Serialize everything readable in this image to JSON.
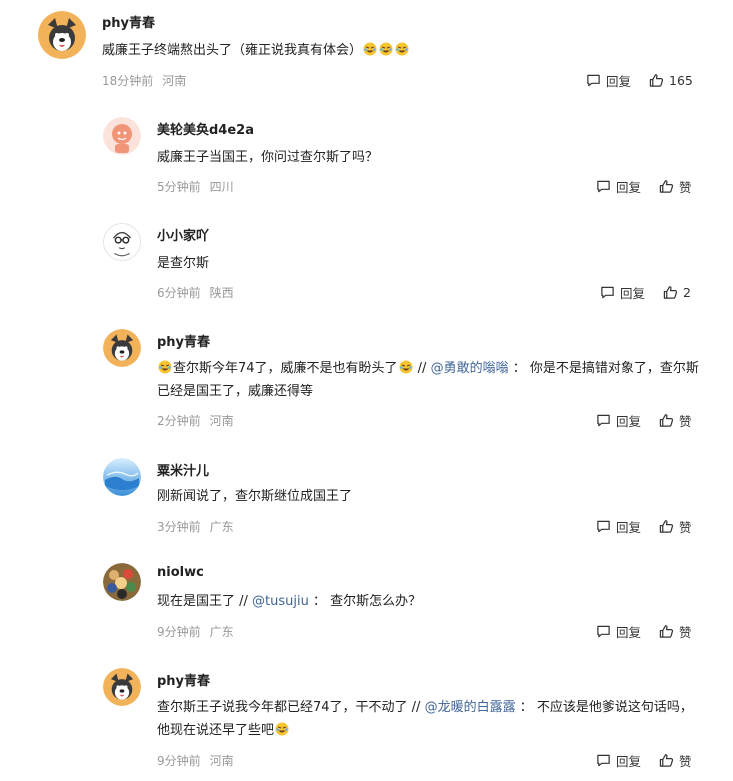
{
  "comments": [
    {
      "author": "phy青春",
      "text_before": "威廉王子终端熬出头了（雍正说我真有体会）",
      "time": "18分钟前",
      "location": "河南",
      "reply_label": "回复",
      "like_label": "165"
    },
    {
      "author": "美轮美奂d4e2a",
      "text": "威廉王子当国王，你问过查尔斯了吗？",
      "time": "5分钟前",
      "location": "四川",
      "reply_label": "回复",
      "like_label": "赞"
    },
    {
      "author": "小小家吖",
      "text": "是查尔斯",
      "time": "6分钟前",
      "location": "陕西",
      "reply_label": "回复",
      "like_label": "2"
    },
    {
      "author": "phy青春",
      "text_a": "查尔斯今年74了，威廉不是也有盼头了",
      "sep": " // ",
      "mention": "@勇敢的嗡嗡",
      "text_b": " ： 你是不是搞错对象了，查尔斯已经是国王了，威廉还得等",
      "time": "2分钟前",
      "location": "河南",
      "reply_label": "回复",
      "like_label": "赞"
    },
    {
      "author": "粟米汁儿",
      "text": "刚新闻说了，查尔斯继位成国王了",
      "time": "3分钟前",
      "location": "广东",
      "reply_label": "回复",
      "like_label": "赞"
    },
    {
      "author": "niolwc",
      "text_a": "现在是国王了",
      "sep": " // ",
      "mention": "@tusujiu",
      "text_b": " ： 查尔斯怎么办？",
      "time": "9分钟前",
      "location": "广东",
      "reply_label": "回复",
      "like_label": "赞"
    },
    {
      "author": "phy青春",
      "text_a": "查尔斯王子说我今年都已经74了，干不动了",
      "sep": " // ",
      "mention": "@龙暖的白露露",
      "text_b": " ： 不应该是他爹说这句话吗，他现在说还早了些吧",
      "time": "9分钟前",
      "location": "河南",
      "reply_label": "回复",
      "like_label": "赞"
    }
  ],
  "icons": {
    "reply": "comment-bubble-icon",
    "like": "thumbs-up-icon",
    "emoji": "rofl-emoji-icon"
  },
  "colors": {
    "mention": "#406599",
    "meta": "#999999",
    "text": "#222222"
  }
}
